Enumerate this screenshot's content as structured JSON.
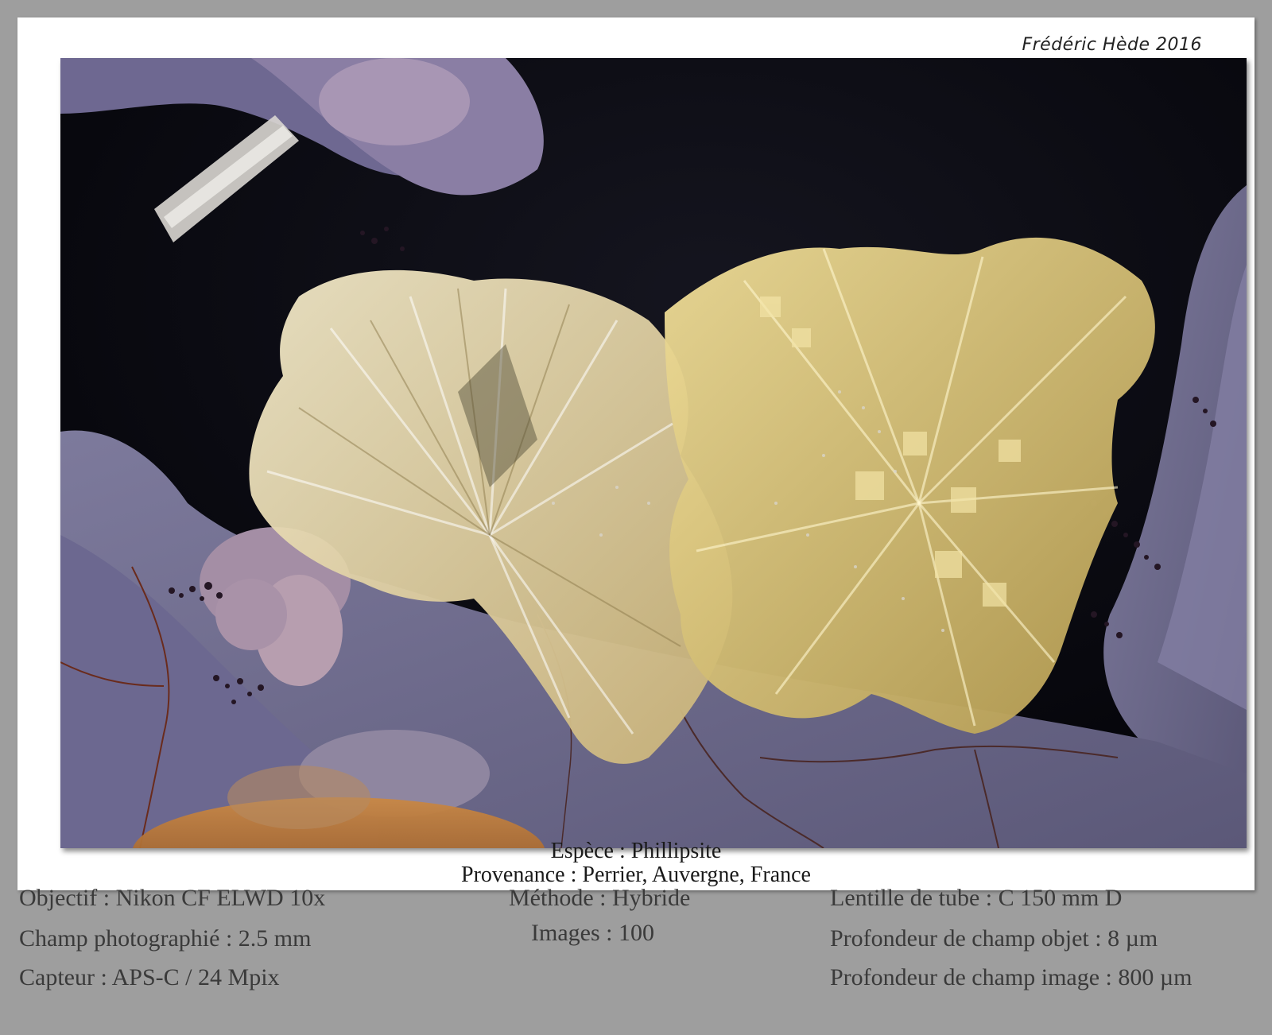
{
  "signature": "Frédéric Hède 2016",
  "caption": {
    "species": "Espèce : Phillipsite",
    "locality": "Provenance : Perrier, Auvergne, France"
  },
  "specs": {
    "objective": "Objectif : Nikon CF ELWD 10x",
    "field": "Champ photographié : 2.5 mm",
    "sensor": "Capteur : APS-C / 24 Mpix",
    "method": "Méthode : Hybride",
    "images": "Images : 100",
    "tube_lens": "Lentille de tube : C 150 mm D",
    "object_dof": "Profondeur de champ objet : 8 µm",
    "image_dof": "Profondeur de champ image : 800 µm"
  },
  "colors": {
    "background": "#9e9e9e",
    "card": "#ffffff",
    "matrix": "#6f6c90",
    "crystal": "#e3cf8c",
    "cavity": "#0b0b14"
  }
}
